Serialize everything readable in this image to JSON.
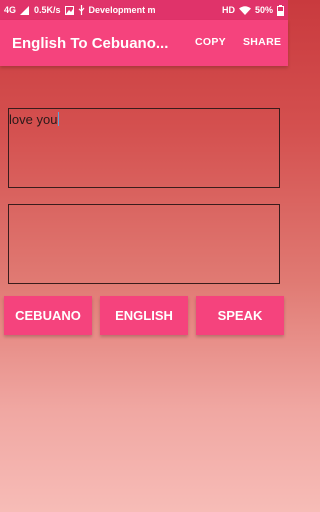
{
  "status_bar": {
    "network": "4G",
    "speed": "0.5K/s",
    "notification": "Development m",
    "hd": "HD",
    "battery": "50%",
    "icons": [
      "signal-icon",
      "image-icon",
      "usb-icon",
      "wifi-icon",
      "battery-icon"
    ]
  },
  "app_bar": {
    "title": "English To Cebuano...",
    "copy_label": "COPY",
    "share_label": "SHARE",
    "color": "#f5437d"
  },
  "input": {
    "value": "love you"
  },
  "output": {
    "value": ""
  },
  "buttons": {
    "cebuano_label": "CEBUANO",
    "english_label": "ENGLISH",
    "speak_label": "SPEAK"
  },
  "colors": {
    "accent": "#f5437d",
    "status_bar": "#e0336a"
  }
}
